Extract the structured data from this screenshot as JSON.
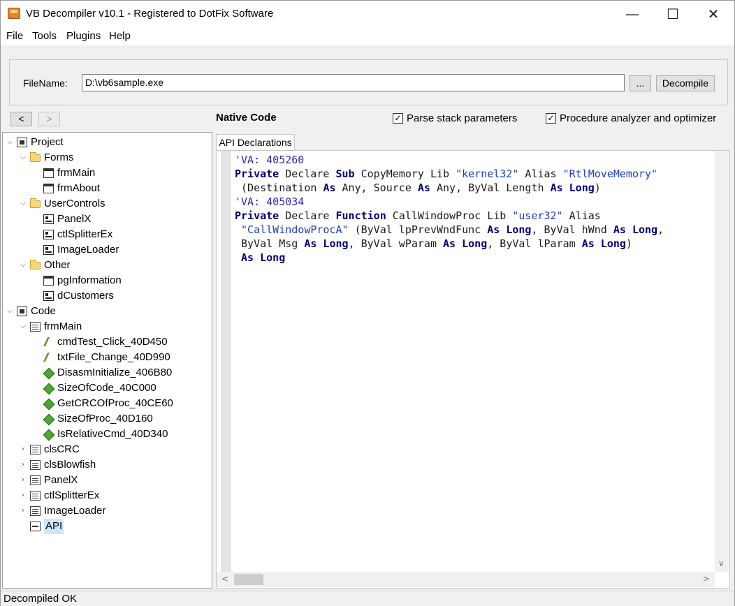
{
  "window": {
    "title": "VB Decompiler v10.1 - Registered to DotFix Software",
    "minimize": "—",
    "maximize": "☐",
    "close": "✕"
  },
  "menu": [
    "File",
    "Tools",
    "Plugins",
    "Help"
  ],
  "file": {
    "label": "FileName:",
    "value": "D:\\vb6sample.exe",
    "browse_label": "...",
    "decompile_label": "Decompile"
  },
  "nav": {
    "back": "<",
    "forward": ">",
    "mode": "Native Code"
  },
  "options": {
    "parse_stack": "Parse stack parameters",
    "parse_stack_checked": true,
    "analyzer": "Procedure analyzer and optimizer",
    "analyzer_checked": true,
    "check_glyph": "✓"
  },
  "tree": {
    "items": [
      {
        "label": "Project",
        "icon": "project-icon",
        "expanded": true
      },
      {
        "label": "Forms",
        "icon": "folder-icon",
        "expanded": true
      },
      {
        "label": "frmMain",
        "icon": "form-icon"
      },
      {
        "label": "frmAbout",
        "icon": "form-icon"
      },
      {
        "label": "UserControls",
        "icon": "folder-icon",
        "expanded": true
      },
      {
        "label": "PanelX",
        "icon": "usercontrol-icon"
      },
      {
        "label": "ctlSplitterEx",
        "icon": "usercontrol-icon"
      },
      {
        "label": "ImageLoader",
        "icon": "usercontrol-icon"
      },
      {
        "label": "Other",
        "icon": "folder-icon",
        "expanded": true
      },
      {
        "label": "pgInformation",
        "icon": "property-page-icon"
      },
      {
        "label": "dCustomers",
        "icon": "data-environment-icon"
      },
      {
        "label": "Code",
        "icon": "code-icon",
        "expanded": true
      },
      {
        "label": "frmMain",
        "icon": "module-icon",
        "expanded": true
      },
      {
        "label": "cmdTest_Click_40D450",
        "icon": "event-icon"
      },
      {
        "label": "txtFile_Change_40D990",
        "icon": "event-icon"
      },
      {
        "label": "DisasmInitialize_406B80",
        "icon": "procedure-icon"
      },
      {
        "label": "SizeOfCode_40C000",
        "icon": "procedure-icon"
      },
      {
        "label": "GetCRCOfProc_40CE60",
        "icon": "procedure-icon"
      },
      {
        "label": "SizeOfProc_40D160",
        "icon": "procedure-icon"
      },
      {
        "label": "IsRelativeCmd_40D340",
        "icon": "procedure-icon"
      },
      {
        "label": "clsCRC",
        "icon": "module-icon",
        "expanded": false
      },
      {
        "label": "clsBlowfish",
        "icon": "module-icon",
        "expanded": false
      },
      {
        "label": "PanelX",
        "icon": "module-icon",
        "expanded": false
      },
      {
        "label": "ctlSplitterEx",
        "icon": "module-icon",
        "expanded": false
      },
      {
        "label": "ImageLoader",
        "icon": "module-icon",
        "expanded": false
      },
      {
        "label": "API",
        "icon": "api-icon",
        "selected": true
      }
    ]
  },
  "editor": {
    "tab": "API Declarations",
    "lines": [
      [
        {
          "t": "'VA: 405260",
          "c": "cmt"
        }
      ],
      [
        {
          "t": "Private",
          "c": "kw"
        },
        {
          "t": " Declare ",
          "c": ""
        },
        {
          "t": "Sub",
          "c": "kw"
        },
        {
          "t": " CopyMemory Lib ",
          "c": ""
        },
        {
          "t": "\"kernel32\"",
          "c": "str"
        },
        {
          "t": " Alias ",
          "c": ""
        },
        {
          "t": "\"RtlMoveMemory\"",
          "c": "str"
        }
      ],
      [
        {
          "t": " (Destination ",
          "c": ""
        },
        {
          "t": "As",
          "c": "kw"
        },
        {
          "t": " Any, Source ",
          "c": ""
        },
        {
          "t": "As",
          "c": "kw"
        },
        {
          "t": " Any, ByVal Length ",
          "c": ""
        },
        {
          "t": "As Long",
          "c": "kw"
        },
        {
          "t": ")",
          "c": ""
        }
      ],
      [
        {
          "t": "'VA: 405034",
          "c": "cmt"
        }
      ],
      [
        {
          "t": "Private",
          "c": "kw"
        },
        {
          "t": " Declare ",
          "c": ""
        },
        {
          "t": "Function",
          "c": "kw"
        },
        {
          "t": " CallWindowProc Lib ",
          "c": ""
        },
        {
          "t": "\"user32\"",
          "c": "str"
        },
        {
          "t": " Alias",
          "c": ""
        }
      ],
      [
        {
          "t": " ",
          "c": ""
        },
        {
          "t": "\"CallWindowProcA\"",
          "c": "str"
        },
        {
          "t": " (ByVal lpPrevWndFunc ",
          "c": ""
        },
        {
          "t": "As Long",
          "c": "kw"
        },
        {
          "t": ", ByVal hWnd ",
          "c": ""
        },
        {
          "t": "As Long",
          "c": "kw"
        },
        {
          "t": ",",
          "c": ""
        }
      ],
      [
        {
          "t": " ByVal Msg ",
          "c": ""
        },
        {
          "t": "As Long",
          "c": "kw"
        },
        {
          "t": ", ByVal wParam ",
          "c": ""
        },
        {
          "t": "As Long",
          "c": "kw"
        },
        {
          "t": ", ByVal lParam ",
          "c": ""
        },
        {
          "t": "As Long",
          "c": "kw"
        },
        {
          "t": ")",
          "c": ""
        }
      ],
      [
        {
          "t": " ",
          "c": ""
        },
        {
          "t": "As Long",
          "c": "kw"
        }
      ]
    ]
  },
  "scroll": {
    "left": "<",
    "right": ">",
    "down": "∨"
  },
  "status": "Decompiled OK"
}
